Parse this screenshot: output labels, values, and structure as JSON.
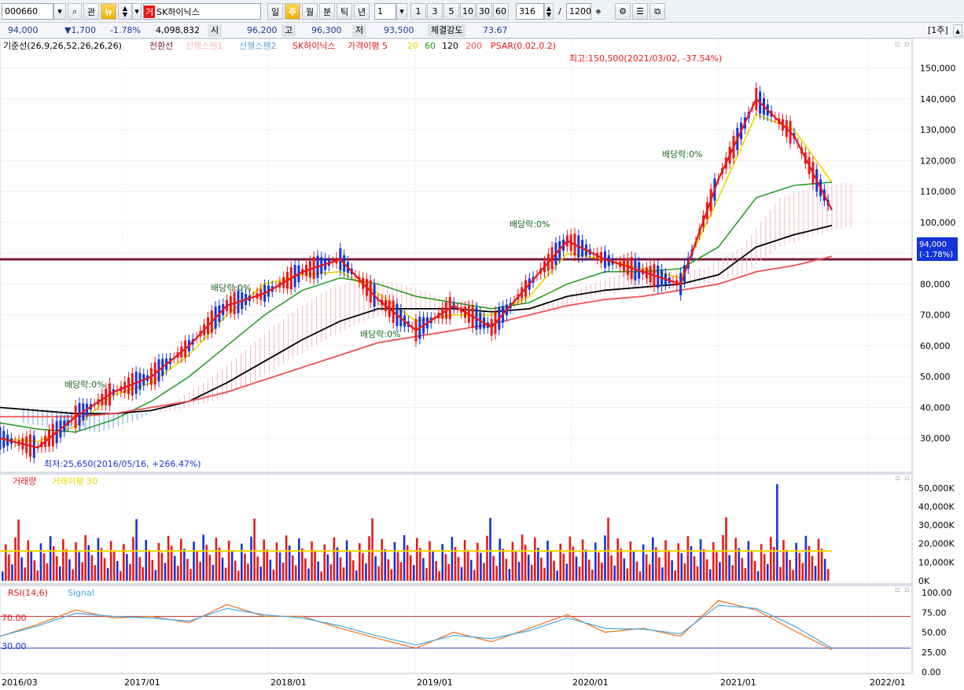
{
  "toolbar": {
    "code": "000660",
    "btn_relation": "관",
    "btn_news": "뉴",
    "stock_badge": "거",
    "stock_name": "SK하이닉스",
    "periods": [
      "일",
      "주",
      "월",
      "분",
      "틱",
      "년"
    ],
    "active_period": "주",
    "interval_value": "1",
    "quick_intervals": [
      "1",
      "3",
      "5",
      "10",
      "30",
      "60"
    ],
    "count_value": "316",
    "separator": "/",
    "total_value": "1200",
    "period_badge": "[1주]"
  },
  "info": {
    "price": "94,000",
    "change": "▼1,700",
    "change_pct": "-1.78%",
    "volume": "4,098,832",
    "open_label": "시",
    "open": "96,200",
    "high_label": "고",
    "high": "96,300",
    "low_label": "저",
    "low": "93,500",
    "strength_label": "체결강도",
    "strength": "73.67"
  },
  "colors": {
    "up": "#e8191a",
    "down": "#1434d8",
    "ma5": "#e8191a",
    "ma20": "#f0d800",
    "ma60": "#1a9a1a",
    "ma120": "#000000",
    "ma200": "#f05050",
    "leading_span1": "#f6b8c0",
    "leading_span2": "#6aa0e8",
    "support_line": "#7a1a3a",
    "rsi": "#f0701a",
    "rsi_signal": "#40a8e8"
  },
  "legend": {
    "price": [
      "기준선(26,9,26,52,26,26,26)",
      "전환선",
      "선행스팬1",
      "선행스팬2",
      "SK하이닉스",
      "가격이평 5",
      "20",
      "60",
      "120",
      "200",
      "PSAR(0.02,0.2)"
    ],
    "volume": [
      "거래량",
      "거래이평 30"
    ],
    "rsi": [
      "RSI(14,6)",
      "Signal"
    ]
  },
  "annotations": {
    "high": "최고:150,500(2021/03/02, -37.54%)",
    "low": "최저:25,650(2016/05/16, +266.47%)",
    "dividend": "배당락:0%",
    "current_price": "94,000",
    "current_change": "(-1.78%)",
    "rsi_70": "70.00",
    "rsi_30": "30.00"
  },
  "chart_data": [
    {
      "type": "line",
      "series_key": "price",
      "x": [
        "2016/03",
        "2016/06",
        "2016/09",
        "2016/12",
        "2017/03",
        "2017/06",
        "2017/09",
        "2017/12",
        "2018/03",
        "2018/06",
        "2018/09",
        "2018/12",
        "2019/03",
        "2019/06",
        "2019/09",
        "2019/12",
        "2020/03",
        "2020/06",
        "2020/09",
        "2020/12",
        "2021/03",
        "2021/06",
        "2021/09"
      ],
      "series": [
        {
          "name": "SK하이닉스",
          "values": [
            30000,
            27000,
            37000,
            45000,
            50000,
            60000,
            73000,
            77000,
            84000,
            88000,
            75000,
            65000,
            73000,
            66000,
            80000,
            94000,
            88000,
            84000,
            80000,
            114000,
            140000,
            128000,
            104000
          ]
        },
        {
          "name": "20",
          "values": [
            30000,
            29000,
            34000,
            44000,
            48000,
            57000,
            70000,
            80000,
            83000,
            84000,
            77000,
            68000,
            70000,
            70000,
            76000,
            90000,
            88000,
            85000,
            82000,
            108000,
            135000,
            130000,
            113000
          ]
        },
        {
          "name": "60",
          "values": [
            35000,
            33000,
            32000,
            36000,
            42000,
            50000,
            60000,
            70000,
            78000,
            82000,
            80000,
            76000,
            74000,
            72000,
            74000,
            80000,
            84000,
            84000,
            85000,
            92000,
            108000,
            112000,
            113000
          ]
        },
        {
          "name": "120",
          "values": [
            40000,
            39000,
            38000,
            38000,
            39000,
            42000,
            48000,
            55000,
            62000,
            68000,
            72000,
            72000,
            72000,
            71000,
            72000,
            76000,
            78000,
            79000,
            80000,
            83000,
            92000,
            96000,
            99000
          ]
        },
        {
          "name": "200",
          "values": [
            37000,
            37000,
            37000,
            38000,
            40000,
            42000,
            45000,
            49000,
            53000,
            57000,
            61000,
            63000,
            65000,
            67000,
            70000,
            73000,
            75000,
            76000,
            78000,
            80000,
            84000,
            86000,
            89000
          ]
        }
      ],
      "ylim": [
        20000,
        155000
      ],
      "yticks": [
        30000,
        40000,
        50000,
        60000,
        70000,
        80000,
        90000,
        100000,
        110000,
        120000,
        130000,
        140000,
        150000
      ],
      "ytick_labels": [
        "30,000",
        "40,000",
        "50,000",
        "60,000",
        "70,000",
        "80,000",
        "",
        "100,000",
        "110,000",
        "120,000",
        "130,000",
        "140,000",
        "150,000"
      ],
      "support": 88000
    },
    {
      "type": "bar",
      "series_key": "volume",
      "ylim": [
        0,
        55000
      ],
      "yticks": [
        0,
        10000,
        20000,
        30000,
        40000,
        50000
      ],
      "ytick_labels": [
        "0K",
        "10,000K",
        "20,000K",
        "30,000K",
        "40,000K",
        "50,000K"
      ],
      "typical_range": [
        5000,
        25000
      ],
      "peak": 52000,
      "ma30_level": 16000
    },
    {
      "type": "line",
      "series_key": "rsi",
      "series": [
        {
          "name": "RSI(14,6)",
          "values": [
            45,
            60,
            78,
            68,
            70,
            62,
            85,
            70,
            70,
            55,
            42,
            30,
            50,
            38,
            55,
            72,
            50,
            55,
            45,
            90,
            78,
            52,
            28
          ]
        },
        {
          "name": "Signal",
          "values": [
            45,
            58,
            74,
            70,
            68,
            64,
            80,
            72,
            68,
            58,
            45,
            34,
            46,
            42,
            52,
            68,
            55,
            54,
            48,
            84,
            80,
            58,
            30
          ]
        }
      ],
      "ylim": [
        0,
        105
      ],
      "yticks": [
        0,
        25,
        50,
        75,
        100
      ],
      "ytick_labels": [
        "0.00",
        "25.00",
        "50.00",
        "75.00",
        "100.00"
      ],
      "levels": [
        70,
        30
      ]
    }
  ],
  "x_axis_labels": [
    "2016/03",
    "2017/01",
    "2018/01",
    "2019/01",
    "2020/01",
    "2021/01",
    "2022/01"
  ]
}
